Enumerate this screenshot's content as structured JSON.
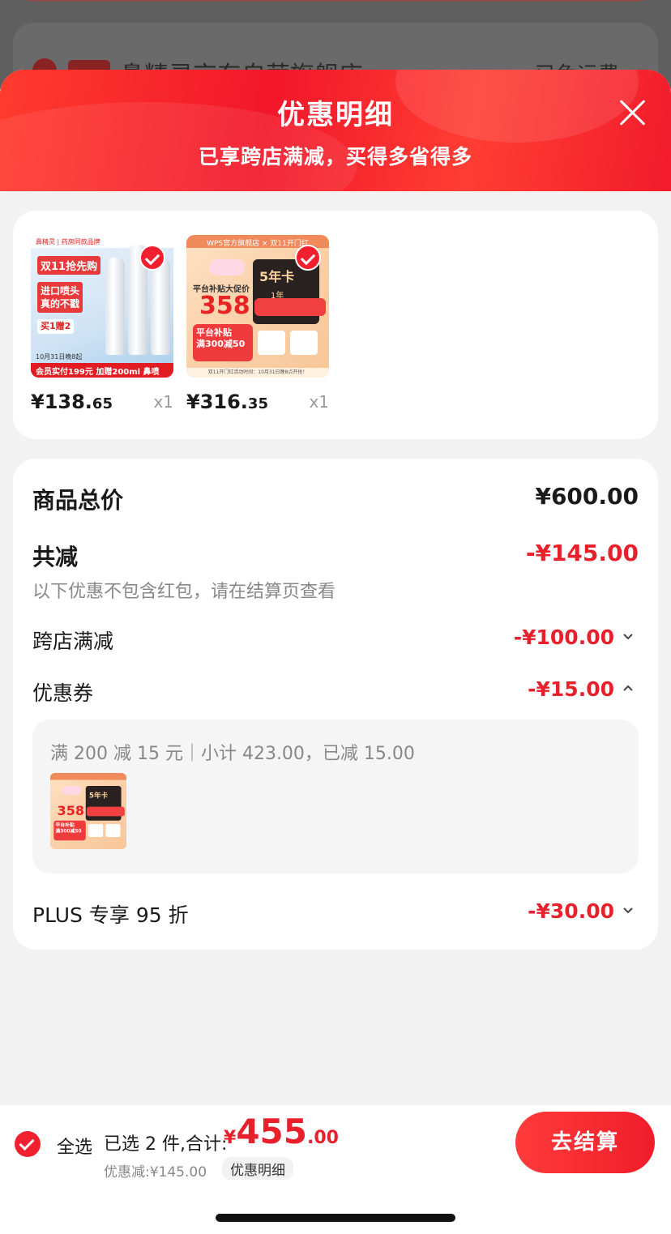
{
  "background": {
    "store_name": "鼻精灵京东自营旗舰店 ›",
    "right_text": "已免运费"
  },
  "sheet": {
    "title": "优惠明细",
    "subtitle": "已享跨店满减，买得多省得多"
  },
  "products": [
    {
      "price_int": "¥138.",
      "price_dec": "65",
      "qty": "x1",
      "image": {
        "top": "鼻精灵 | 药房同款品牌",
        "headline": "双11抢先购",
        "headline2": "进口喷头\n真的不戳",
        "gift": "买1赠2",
        "date": "10月31日晚8起",
        "bottom": "会员实付199元 加赠200ml 鼻喷"
      }
    },
    {
      "price_int": "¥316.",
      "price_dec": "35",
      "qty": "x1",
      "image": {
        "top": "WPS官方旗舰店 × 双11开门红",
        "left": "平台补贴大促价",
        "big": "358",
        "card_title": "5年卡",
        "card_sub": "1年",
        "box": "平台补贴\n满300减50",
        "bottom": "双11开门红活动时间：10月31日晚8点开抢！"
      }
    }
  ],
  "summary": {
    "total_label": "商品总价",
    "total_value": "¥600.00",
    "reduce_label": "共减",
    "reduce_value": "-¥145.00",
    "note": "以下优惠不包含红包，请在结算页查看",
    "cross_label": "跨店满减",
    "cross_value": "-¥100.00",
    "coupon_label": "优惠券",
    "coupon_value": "-¥15.00",
    "coupon_detail": "满 200 减 15 元｜小计 423.00，已减 15.00",
    "plus_label": "PLUS 专享 95 折",
    "plus_value": "-¥30.00"
  },
  "bottom": {
    "select_all": "全选",
    "selected_text": "已选 2 件,合计:",
    "currency": "¥",
    "total_int": "455",
    "total_dec": ".00",
    "discount_text": "优惠减:¥145.00",
    "detail_link": "优惠明细",
    "checkout": "去结算"
  },
  "colors": {
    "accent_red": "#e8202c",
    "header_red": "#f2172a"
  }
}
